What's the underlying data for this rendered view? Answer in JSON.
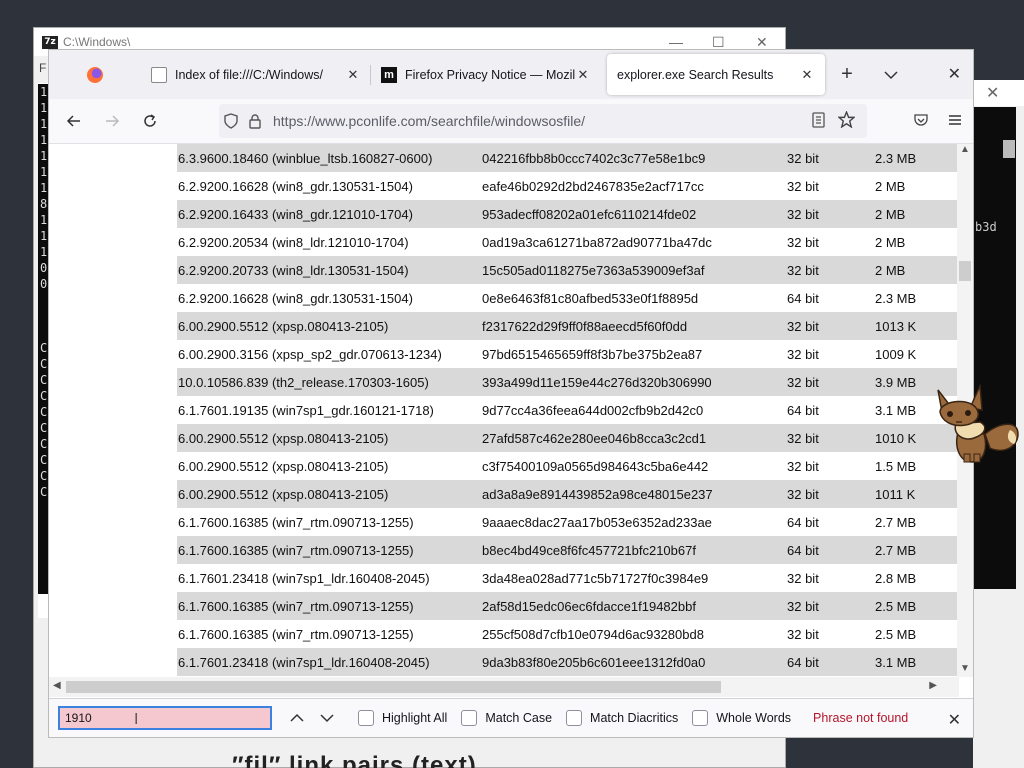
{
  "background": {
    "sevenzip": {
      "title": "C:\\Windows\\",
      "menu_letter": "F",
      "logo": "7z"
    },
    "console_left_chars": [
      "1",
      "1",
      "1",
      "1",
      "1",
      "1",
      "1",
      "8",
      "1",
      "1",
      "1",
      "0",
      "0",
      "",
      "",
      "",
      "C",
      "C",
      "C",
      "C",
      "C",
      "C",
      "C",
      "C",
      "C",
      "C"
    ],
    "right_window": {
      "close": "✕",
      "text": "b3d"
    },
    "bottom_text": "″fil″ link pairs (text)"
  },
  "browser": {
    "tabs": [
      {
        "label": "Index of file:///C:/Windows/",
        "icon": "document-icon"
      },
      {
        "label": "Firefox Privacy Notice — Mozilla",
        "icon": "mozilla-icon"
      },
      {
        "label": "explorer.exe Search Results",
        "active": true
      }
    ],
    "new_tab": "+",
    "url": "https://www.pconlife.com/searchfile/windowsosfile/"
  },
  "table": {
    "rows": [
      {
        "version": "6.3.9600.18460 (winblue_ltsb.160827-0600)",
        "hash": "042216fbb8b0ccc7402c3c77e58e1bc9",
        "bits": "32 bit",
        "size": "2.3 MB"
      },
      {
        "version": "6.2.9200.16628 (win8_gdr.130531-1504)",
        "hash": "eafe46b0292d2bd2467835e2acf717cc",
        "bits": "32 bit",
        "size": "2 MB"
      },
      {
        "version": "6.2.9200.16433 (win8_gdr.121010-1704)",
        "hash": "953adecff08202a01efc6110214fde02",
        "bits": "32 bit",
        "size": "2 MB"
      },
      {
        "version": "6.2.9200.20534 (win8_ldr.121010-1704)",
        "hash": "0ad19a3ca61271ba872ad90771ba47dc",
        "bits": "32 bit",
        "size": "2 MB"
      },
      {
        "version": "6.2.9200.20733 (win8_ldr.130531-1504)",
        "hash": "15c505ad0118275e7363a539009ef3af",
        "bits": "32 bit",
        "size": "2 MB"
      },
      {
        "version": "6.2.9200.16628 (win8_gdr.130531-1504)",
        "hash": "0e8e6463f81c80afbed533e0f1f8895d",
        "bits": "64 bit",
        "size": "2.3 MB"
      },
      {
        "version": "6.00.2900.5512 (xpsp.080413-2105)",
        "hash": "f2317622d29f9ff0f88aeecd5f60f0dd",
        "bits": "32 bit",
        "size": "1013 K"
      },
      {
        "version": "6.00.2900.3156 (xpsp_sp2_gdr.070613-1234)",
        "hash": "97bd6515465659ff8f3b7be375b2ea87",
        "bits": "32 bit",
        "size": "1009 K"
      },
      {
        "version": "10.0.10586.839 (th2_release.170303-1605)",
        "hash": "393a499d11e159e44c276d320b306990",
        "bits": "32 bit",
        "size": "3.9 MB"
      },
      {
        "version": "6.1.7601.19135 (win7sp1_gdr.160121-1718)",
        "hash": "9d77cc4a36feea644d002cfb9b2d42c0",
        "bits": "64 bit",
        "size": "3.1 MB"
      },
      {
        "version": "6.00.2900.5512 (xpsp.080413-2105)",
        "hash": "27afd587c462e280ee046b8cca3c2cd1",
        "bits": "32 bit",
        "size": "1010 K"
      },
      {
        "version": "6.00.2900.5512 (xpsp.080413-2105)",
        "hash": "c3f75400109a0565d984643c5ba6e442",
        "bits": "32 bit",
        "size": "1.5 MB"
      },
      {
        "version": "6.00.2900.5512 (xpsp.080413-2105)",
        "hash": "ad3a8a9e8914439852a98ce48015e237",
        "bits": "32 bit",
        "size": "1011 K"
      },
      {
        "version": "6.1.7600.16385 (win7_rtm.090713-1255)",
        "hash": "9aaaec8dac27aa17b053e6352ad233ae",
        "bits": "64 bit",
        "size": "2.7 MB"
      },
      {
        "version": "6.1.7600.16385 (win7_rtm.090713-1255)",
        "hash": "b8ec4bd49ce8f6fc457721bfc210b67f",
        "bits": "64 bit",
        "size": "2.7 MB"
      },
      {
        "version": "6.1.7601.23418 (win7sp1_ldr.160408-2045)",
        "hash": "3da48ea028ad771c5b71727f0c3984e9",
        "bits": "32 bit",
        "size": "2.8 MB"
      },
      {
        "version": "6.1.7600.16385 (win7_rtm.090713-1255)",
        "hash": "2af58d15edc06ec6fdacce1f19482bbf",
        "bits": "32 bit",
        "size": "2.5 MB"
      },
      {
        "version": "6.1.7600.16385 (win7_rtm.090713-1255)",
        "hash": "255cf508d7cfb10e0794d6ac93280bd8",
        "bits": "32 bit",
        "size": "2.5 MB"
      },
      {
        "version": "6.1.7601.23418 (win7sp1_ldr.160408-2045)",
        "hash": "9da3b83f80e205b6c601eee1312fd0a0",
        "bits": "64 bit",
        "size": "3.1 MB"
      }
    ]
  },
  "findbar": {
    "value": "1910",
    "options": [
      "Highlight All",
      "Match Case",
      "Match Diacritics",
      "Whole Words"
    ],
    "status": "Phrase not found",
    "status_color": "#b5162b"
  }
}
